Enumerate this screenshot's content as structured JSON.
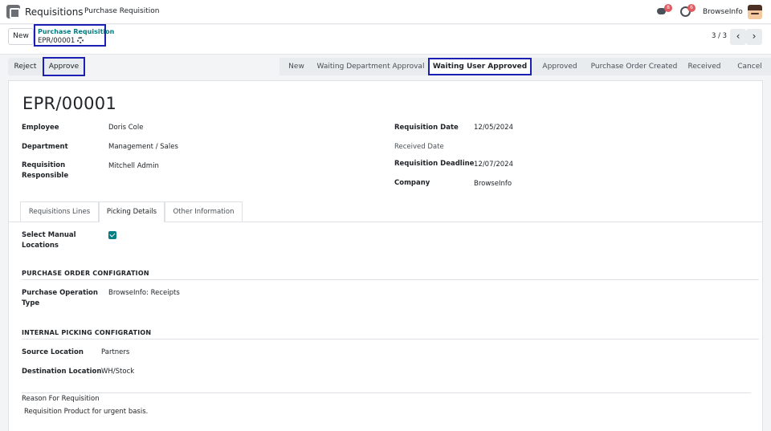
{
  "navbar": {
    "app_name": "Requisitions",
    "menu_item": "Purchase Requisition",
    "chat_count": "8",
    "activity_count": "6",
    "company": "BrowseInfo"
  },
  "control": {
    "new_label": "New",
    "breadcrumb_parent": "Purchase Requisition",
    "breadcrumb_current": "EPR/00001",
    "pager": "3 / 3",
    "prev_glyph": "‹",
    "next_glyph": "›"
  },
  "actions": {
    "reject_label": "Reject",
    "approve_label": "Approve"
  },
  "stages": [
    {
      "label": "New"
    },
    {
      "label": "Waiting Department Approval"
    },
    {
      "label": "Waiting User Approved",
      "current": true
    },
    {
      "label": "Approved"
    },
    {
      "label": "Purchase Order Created"
    },
    {
      "label": "Received"
    },
    {
      "label": "Cancel"
    }
  ],
  "record": {
    "title": "EPR/00001",
    "employee_label": "Employee",
    "employee": "Doris Cole",
    "department_label": "Department",
    "department": "Management / Sales",
    "responsible_label": "Requisition Responsible",
    "responsible": "Mitchell Admin",
    "req_date_label": "Requisition Date",
    "req_date": "12/05/2024",
    "received_date_label": "Received Date",
    "received_date": "",
    "deadline_label": "Requisition Deadline",
    "deadline": "12/07/2024",
    "company_label": "Company",
    "company": "BrowseInfo"
  },
  "tabs": [
    {
      "label": "Requisitions Lines"
    },
    {
      "label": "Picking Details",
      "active": true
    },
    {
      "label": "Other Information"
    }
  ],
  "picking": {
    "manual_locations_label": "Select Manual Locations",
    "manual_locations_checked": true,
    "po_section": "PURCHASE ORDER CONFIGRATION",
    "operation_type_label": "Purchase Operation Type",
    "operation_type": "BrowseInfo: Receipts",
    "internal_section": "INTERNAL PICKING CONFIGRATION",
    "source_label": "Source Location",
    "source": "Partners",
    "destination_label": "Destination Location",
    "destination": "WH/Stock",
    "reason_label": "Reason For Requisition",
    "reason": "Requisition Product for urgent basis."
  },
  "colors": {
    "highlight_border": "#1c1fb4",
    "accent": "#017e84",
    "badge": "#e05a62"
  }
}
